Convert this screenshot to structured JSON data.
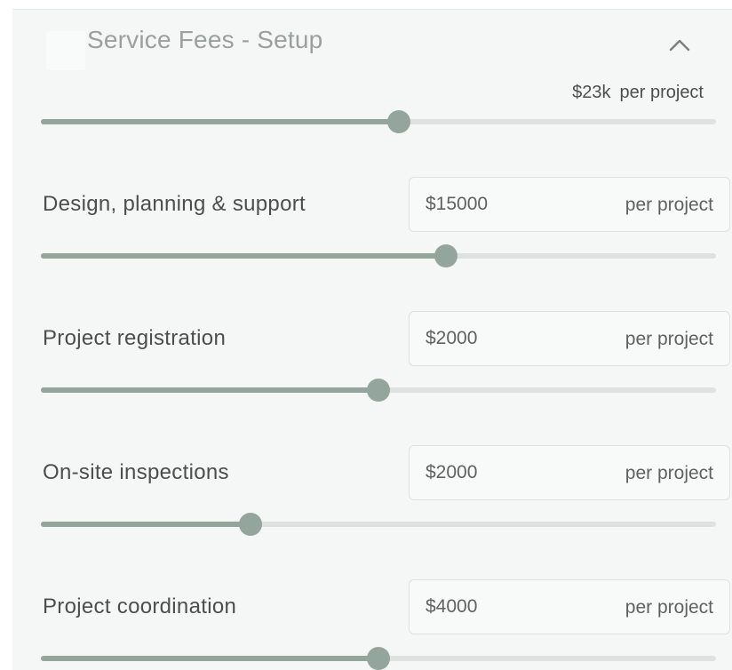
{
  "section": {
    "title": "Service Fees - Setup",
    "collapse_icon": "chevron-up-icon"
  },
  "total": {
    "amount": "$23k",
    "unit": "per project",
    "slider_percent": 53
  },
  "fees": [
    {
      "label": "Design, planning & support",
      "value": "$15000",
      "unit": "per project",
      "slider_percent": 60
    },
    {
      "label": "Project registration",
      "value": "$2000",
      "unit": "per project",
      "slider_percent": 50
    },
    {
      "label": "On-site inspections",
      "value": "$2000",
      "unit": "per project",
      "slider_percent": 31
    },
    {
      "label": "Project coordination",
      "value": "$4000",
      "unit": "per project",
      "slider_percent": 50
    }
  ],
  "colors": {
    "panel_bg": "#f5f7f6",
    "slider_fill": "#94a59d",
    "slider_track": "#dde2e0",
    "text": "#4a4f4d",
    "header_text": "#9aa09d"
  }
}
